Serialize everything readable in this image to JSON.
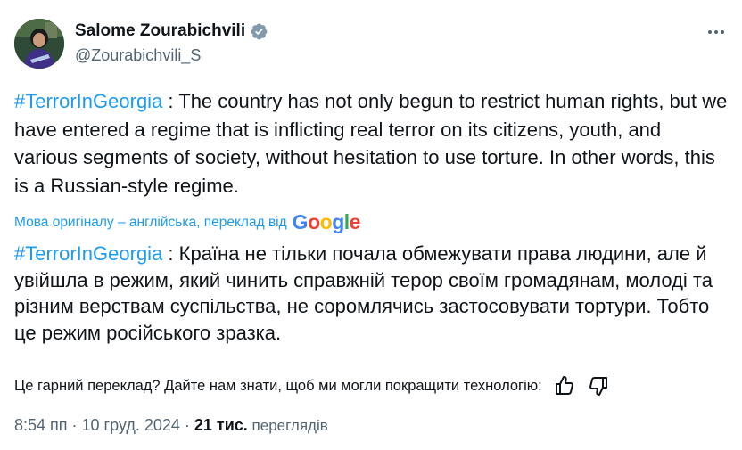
{
  "author": {
    "name": "Salome Zourabichvili",
    "handle": "@Zourabichvili_S",
    "verified_color": "#829aab"
  },
  "tweet": {
    "hashtag": "#TerrorInGeorgia",
    "text": " : The country has not only begun to restrict human rights, but we have entered a regime that is inflicting real terror on its citizens, youth, and various segments of society, without hesitation to use torture. In other words, this is a Russian-style regime."
  },
  "translation_note": {
    "label": "Мова оригіналу – англійська, переклад від",
    "provider": "Google"
  },
  "translation": {
    "hashtag": "#TerrorInGeorgia",
    "text": " : Країна не тільки почала обмежувати права людини, але й увійшла в режим, який чинить справжній терор своїм громадянам, молоді та різним верствам суспільства, не соромлячись застосовувати тортури. Тобто це режим російського зразка."
  },
  "feedback": {
    "question": "Це гарний переклад? Дайте нам знати, щоб ми могли покращити технологію:"
  },
  "meta": {
    "time": "8:54 пп",
    "separator": " · ",
    "date": "10 груд. 2024",
    "views_count": "21 тис.",
    "views_label": " переглядів"
  },
  "colors": {
    "link": "#1d9bf0",
    "secondary_text": "#536471",
    "primary_text": "#0f1419"
  }
}
